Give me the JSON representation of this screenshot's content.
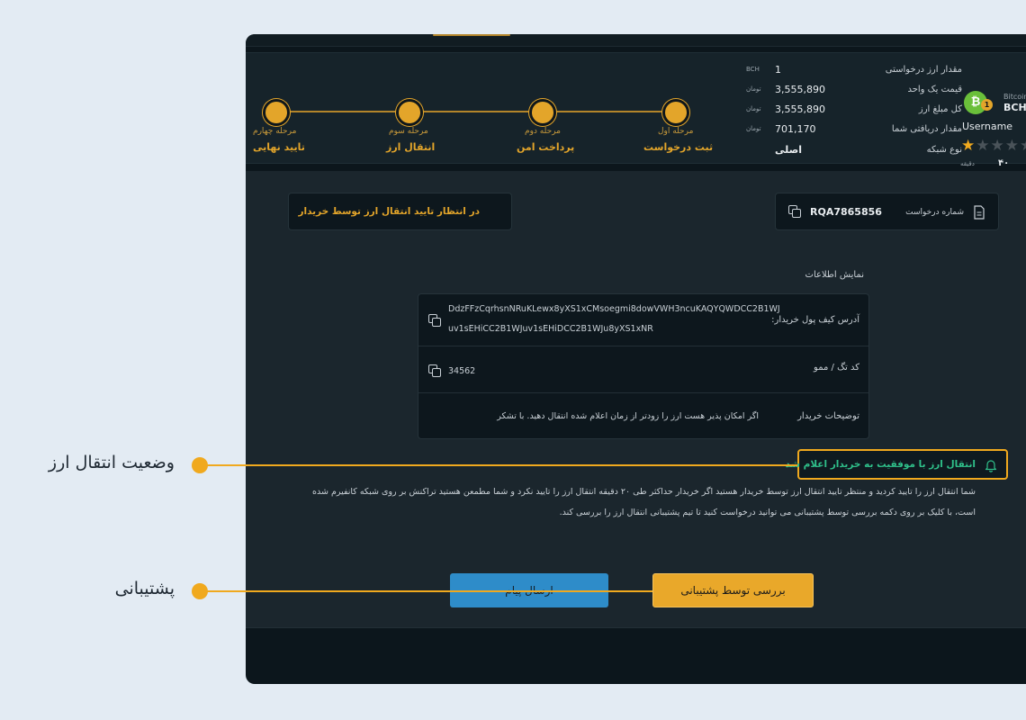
{
  "user": {
    "coin_symbol": "BCH",
    "coin_name": "Bitcoin",
    "badge": "1",
    "username": "Username",
    "time_value": "۴۰",
    "time_unit": "دقیقه",
    "rating_stars": 1,
    "rating_max": 5
  },
  "order_details": [
    {
      "label": "مقدار ارز درخواستی",
      "value": "1",
      "unit": "BCH"
    },
    {
      "label": "قیمت یک واحد",
      "value": "3,555,890",
      "unit": "تومان"
    },
    {
      "label": "کل مبلغ ارز",
      "value": "3,555,890",
      "unit": "تومان"
    },
    {
      "label": "مقدار دریافتی شما",
      "value": "701,170",
      "unit": "تومان"
    },
    {
      "label": "نوع شبکه",
      "value": "اصلی",
      "unit": ""
    }
  ],
  "steps": [
    {
      "sub": "مرحله اول",
      "title": "ثبت درخواست"
    },
    {
      "sub": "مرحله دوم",
      "title": "پرداخت امن"
    },
    {
      "sub": "مرحله سوم",
      "title": "انتقال ارز"
    },
    {
      "sub": "مرحله چهارم",
      "title": "تایید نهایی"
    }
  ],
  "request": {
    "label": "شماره درخواست",
    "number": "RQA7865856"
  },
  "status_box": "در انتظار تایید انتقال ارز توسط خریدار",
  "info_section_title": "نمایش اطلاعات",
  "info": {
    "wallet_label": "آدرس کیف پول خریدار:",
    "wallet_line1": "DdzFFzCqrhsnNRuKLewx8yXS1xCMsoegmi8dowVWH3ncuKAQYQWDCC2B1WJ",
    "wallet_line2": "uv1sEHiCC2B1WJuv1sEHiDCC2B1WJu8yXS1xNR",
    "memo_label": "کد تگ / ممو",
    "memo_value": "34562",
    "desc_label": "توضیحات خریدار",
    "desc_value": "اگر امکان پذیر هست ارز را زودتر از زمان اعلام شده انتقال دهید. با تشکر"
  },
  "notice": "انتقال ارز با موفقیت به خریدار اعلام شد",
  "paragraph": {
    "line1": "شما انتقال ارز را تایید کردید و منتظر تایید انتقال ارز توسط خریدار هستید اگر خریدار حداکثر طی ۲۰ دقیقه انتقال ارز را تایید نکرد و شما مطمعن هستید تراکنش بر روی شبکه کانفیرم شده",
    "line2": "است، با کلیک بر روی دکمه بررسی توسط پشتیبانی می توانید درخواست کنید تا تیم پشتیبانی انتقال ارز را بررسی کند."
  },
  "buttons": {
    "support": "بررسی توسط پشتیبانی",
    "send": "ارسال پیام"
  },
  "callouts": {
    "status": "وضعیت انتقال ارز",
    "support": "پشتیبانی"
  },
  "colors": {
    "accent": "#f0a91e",
    "success": "#2fc08a",
    "send_button": "#2e8cc9",
    "panel": "#1b262d",
    "coin": "#6abf3a"
  }
}
